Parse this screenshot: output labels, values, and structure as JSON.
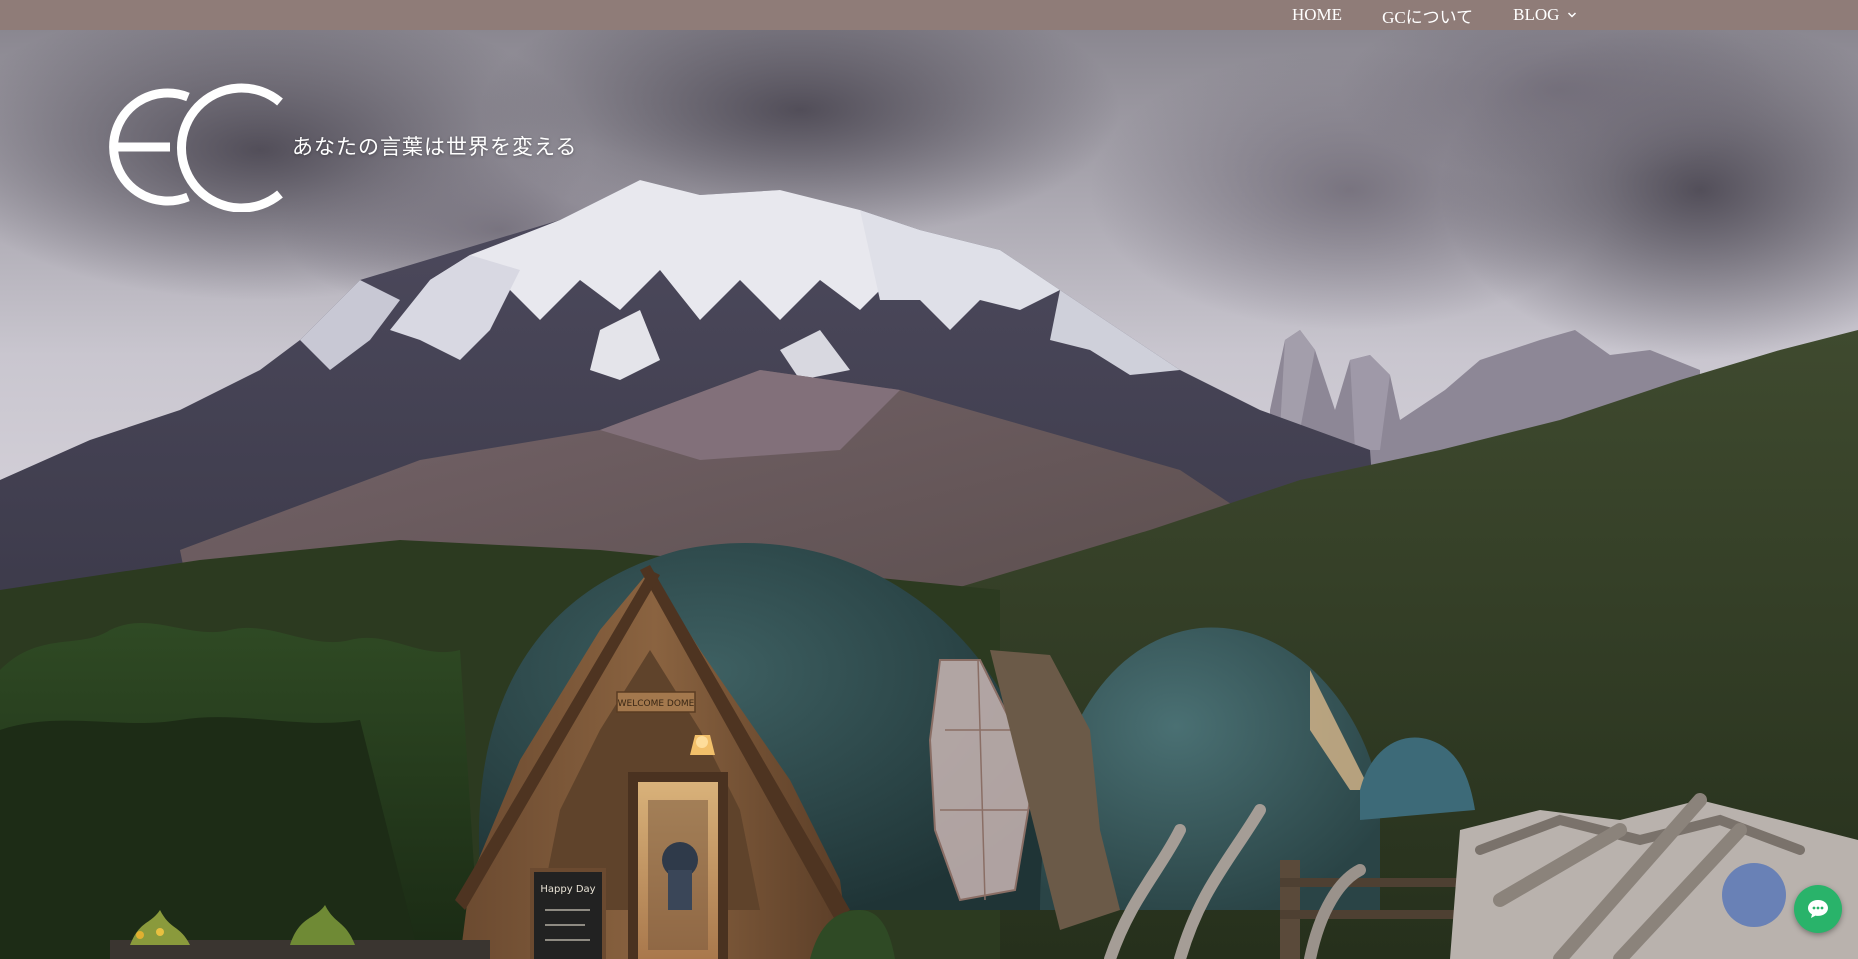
{
  "nav": {
    "items": [
      {
        "label": "HOME"
      },
      {
        "label": "GCについて"
      },
      {
        "label": "BLOG",
        "has_dropdown": true
      }
    ]
  },
  "header": {
    "tagline": "あなたの言葉は世界を変える",
    "logo_text": "GC"
  },
  "hero": {
    "signs": {
      "welcome": "WELCOME DOME",
      "chalkboard": "Happy Day"
    }
  },
  "chat": {
    "icon": "chat-bubble-icon"
  },
  "colors": {
    "topbar": "#8f7c78",
    "chat_button": "#29b36a",
    "nav_text": "#ffffff"
  }
}
